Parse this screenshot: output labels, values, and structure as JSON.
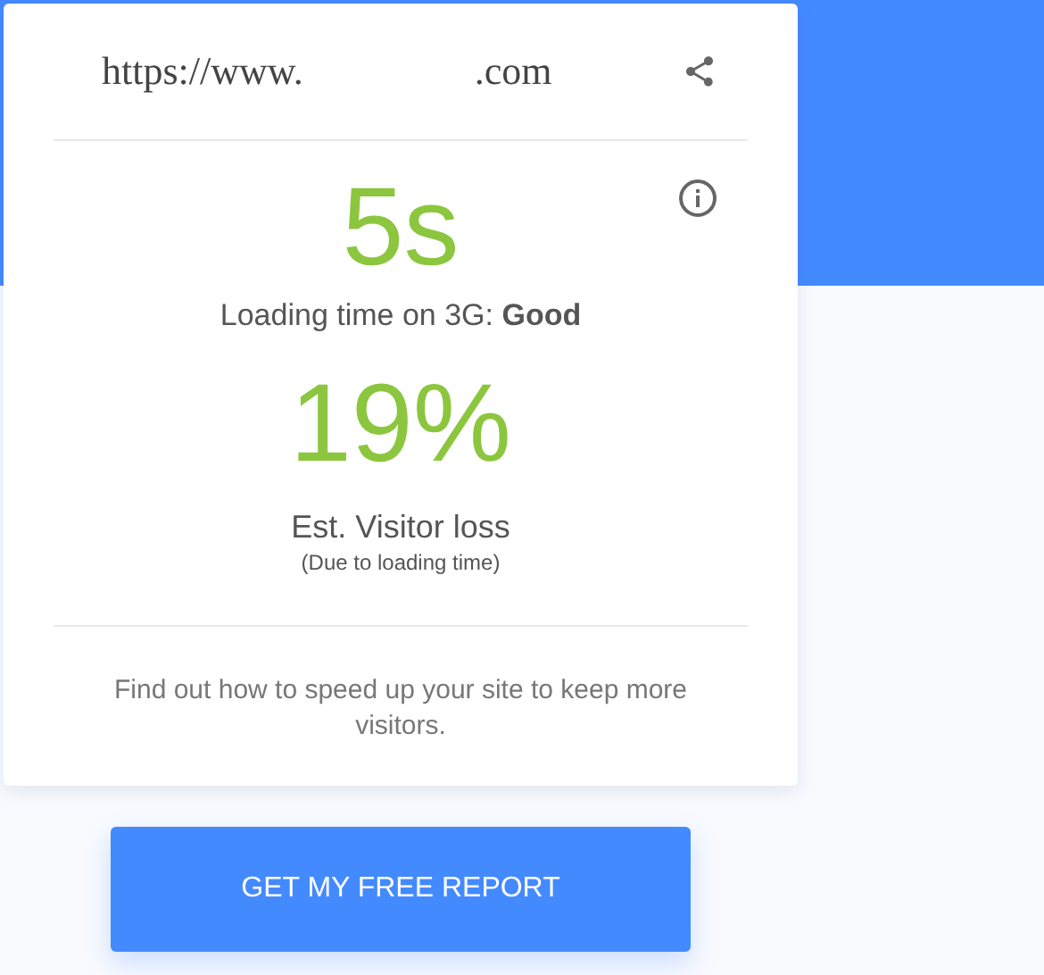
{
  "site": {
    "url_start": "https://www.",
    "url_end": ".com"
  },
  "loading": {
    "value": "5s",
    "caption": "Loading time on 3G: **Good**"
  },
  "visitor_loss": {
    "value": "19%",
    "caption": "Est. Visitor loss",
    "note": "(Due to loading time)"
  },
  "message": "Find out how to speed up your site to keep more visitors.",
  "button": "GET MY FREE REPORT"
}
